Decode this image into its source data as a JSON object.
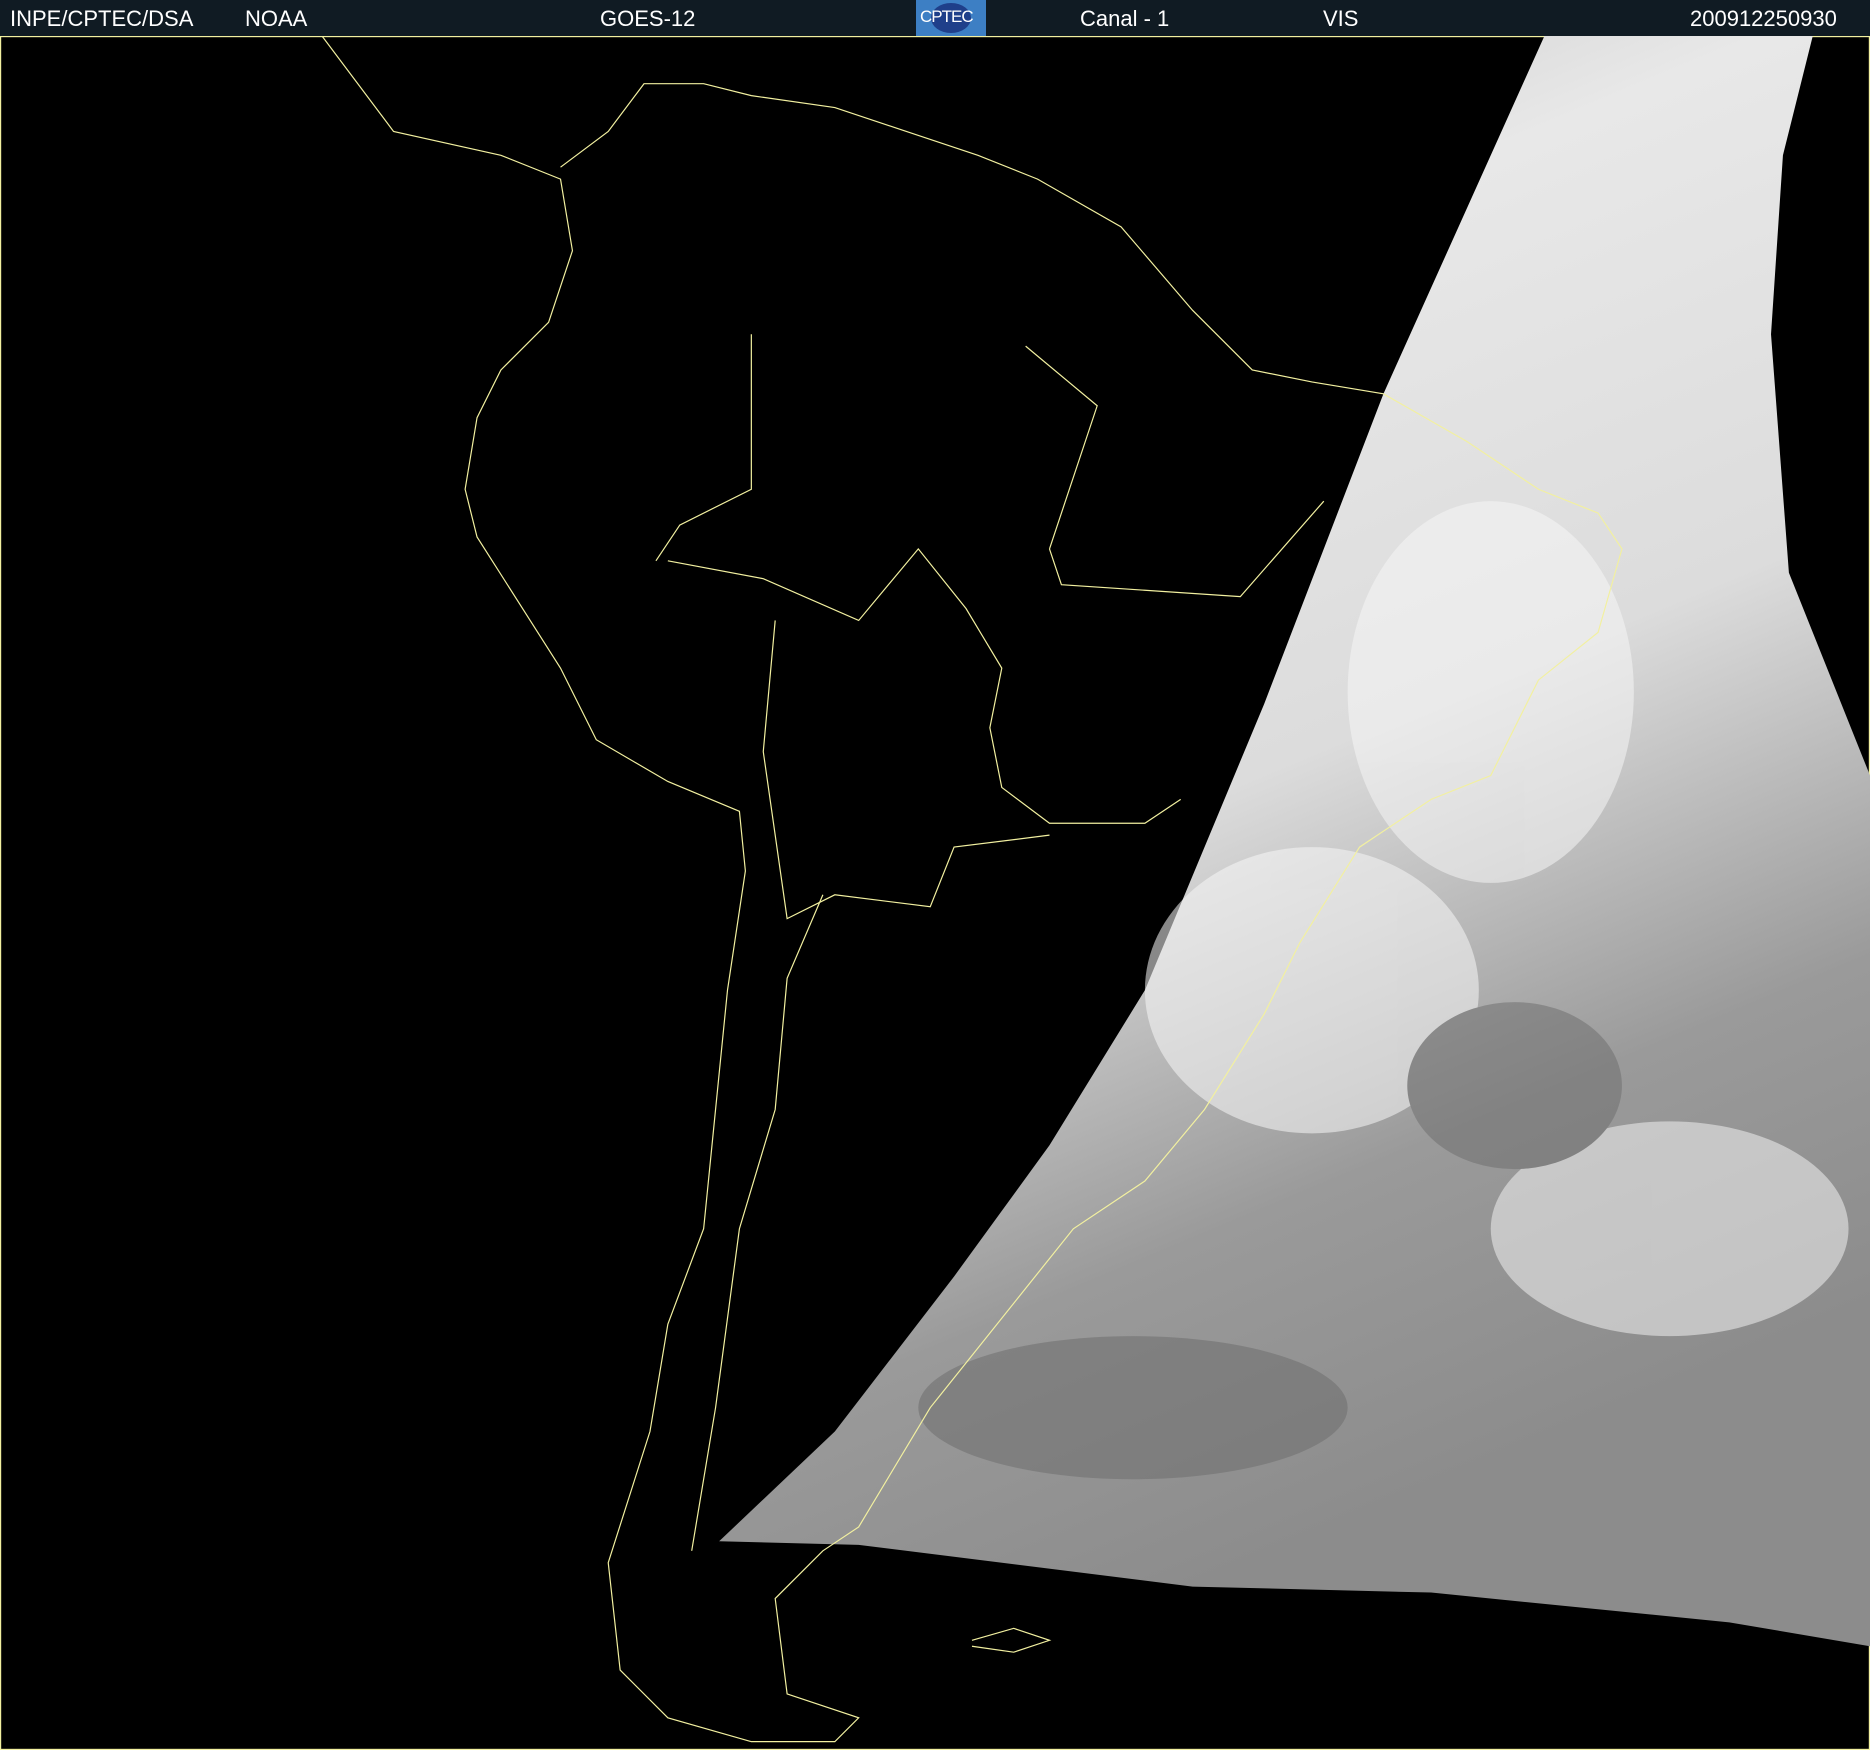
{
  "header": {
    "institution": "INPE/CPTEC/DSA",
    "agency": "NOAA",
    "satellite": "GOES-12",
    "logo_text": "CPTEC",
    "channel": "Canal - 1",
    "band": "VIS",
    "timestamp": "200912250930"
  },
  "colors": {
    "header_bg": "#101b23",
    "coastline": "#f2f0a0",
    "background": "#000000"
  }
}
